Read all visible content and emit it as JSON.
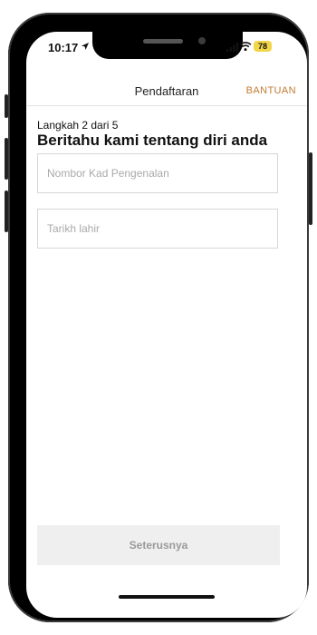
{
  "status_bar": {
    "time": "10:17",
    "battery": "78",
    "icons": [
      "location-icon",
      "signal-icon",
      "wifi-icon",
      "battery-icon"
    ]
  },
  "nav": {
    "title": "Pendaftaran",
    "help_label": "BANTUAN"
  },
  "form": {
    "step_label": "Langkah 2 dari 5",
    "heading": "Beritahu kami tentang diri anda",
    "id_number": {
      "placeholder": "Nombor Kad Pengenalan",
      "value": ""
    },
    "birth_date": {
      "placeholder": "Tarikh lahir",
      "value": ""
    }
  },
  "footer": {
    "next_label": "Seterusnya"
  },
  "colors": {
    "accent": "#c37a2f",
    "battery_bg": "#f2d64a",
    "disabled_button_bg": "#efefef",
    "disabled_button_text": "#9a9a9a"
  }
}
